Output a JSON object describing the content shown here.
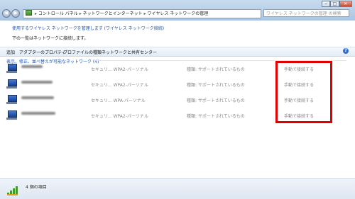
{
  "window": {
    "minimize": "−",
    "maximize": "□",
    "close": "✕"
  },
  "nav": {
    "back": "◀",
    "forward": "▶",
    "breadcrumb": [
      "コントロール パネル",
      "ネットワークとインターネット",
      "ワイヤレス ネットワークの管理"
    ],
    "separator": "▸",
    "search_placeholder": "ワイヤレス ネットワークの管理 の検索"
  },
  "content": {
    "heading": "使用するワイヤレス ネットワークを管理します (ワイヤレス ネットワーク接続)",
    "subtext": "下の一覧はネットワークに接続します。"
  },
  "toolbar": {
    "items": [
      "追加",
      "アダプターのプロパティ",
      "プロファイルの種類",
      "ネットワークと共有センター"
    ],
    "help": "?"
  },
  "list": {
    "group_header": "表示、修正、並べ替えが可能なネットワーク (4)",
    "rows": [
      {
        "name": "",
        "security": "セキュリ... WPA2-パーソナル",
        "type": "種類: サポートされているもの",
        "mode": "手動で接続する"
      },
      {
        "name": "",
        "security": "セキュリ... WPA2-パーソナル",
        "type": "種類: サポートされているもの",
        "mode": "手動で接続する"
      },
      {
        "name": "",
        "security": "セキュリ... WPA-パーソナル",
        "type": "種類: サポートされているもの",
        "mode": "手動で接続する"
      },
      {
        "name": "",
        "security": "セキュリ... WPA2-パーソナル",
        "type": "種類: サポートされているもの",
        "mode": "手動で接続する"
      }
    ]
  },
  "status": {
    "item_count": "4 個の項目"
  },
  "colors": {
    "highlight": "#e10000",
    "link": "#1a55b5"
  }
}
